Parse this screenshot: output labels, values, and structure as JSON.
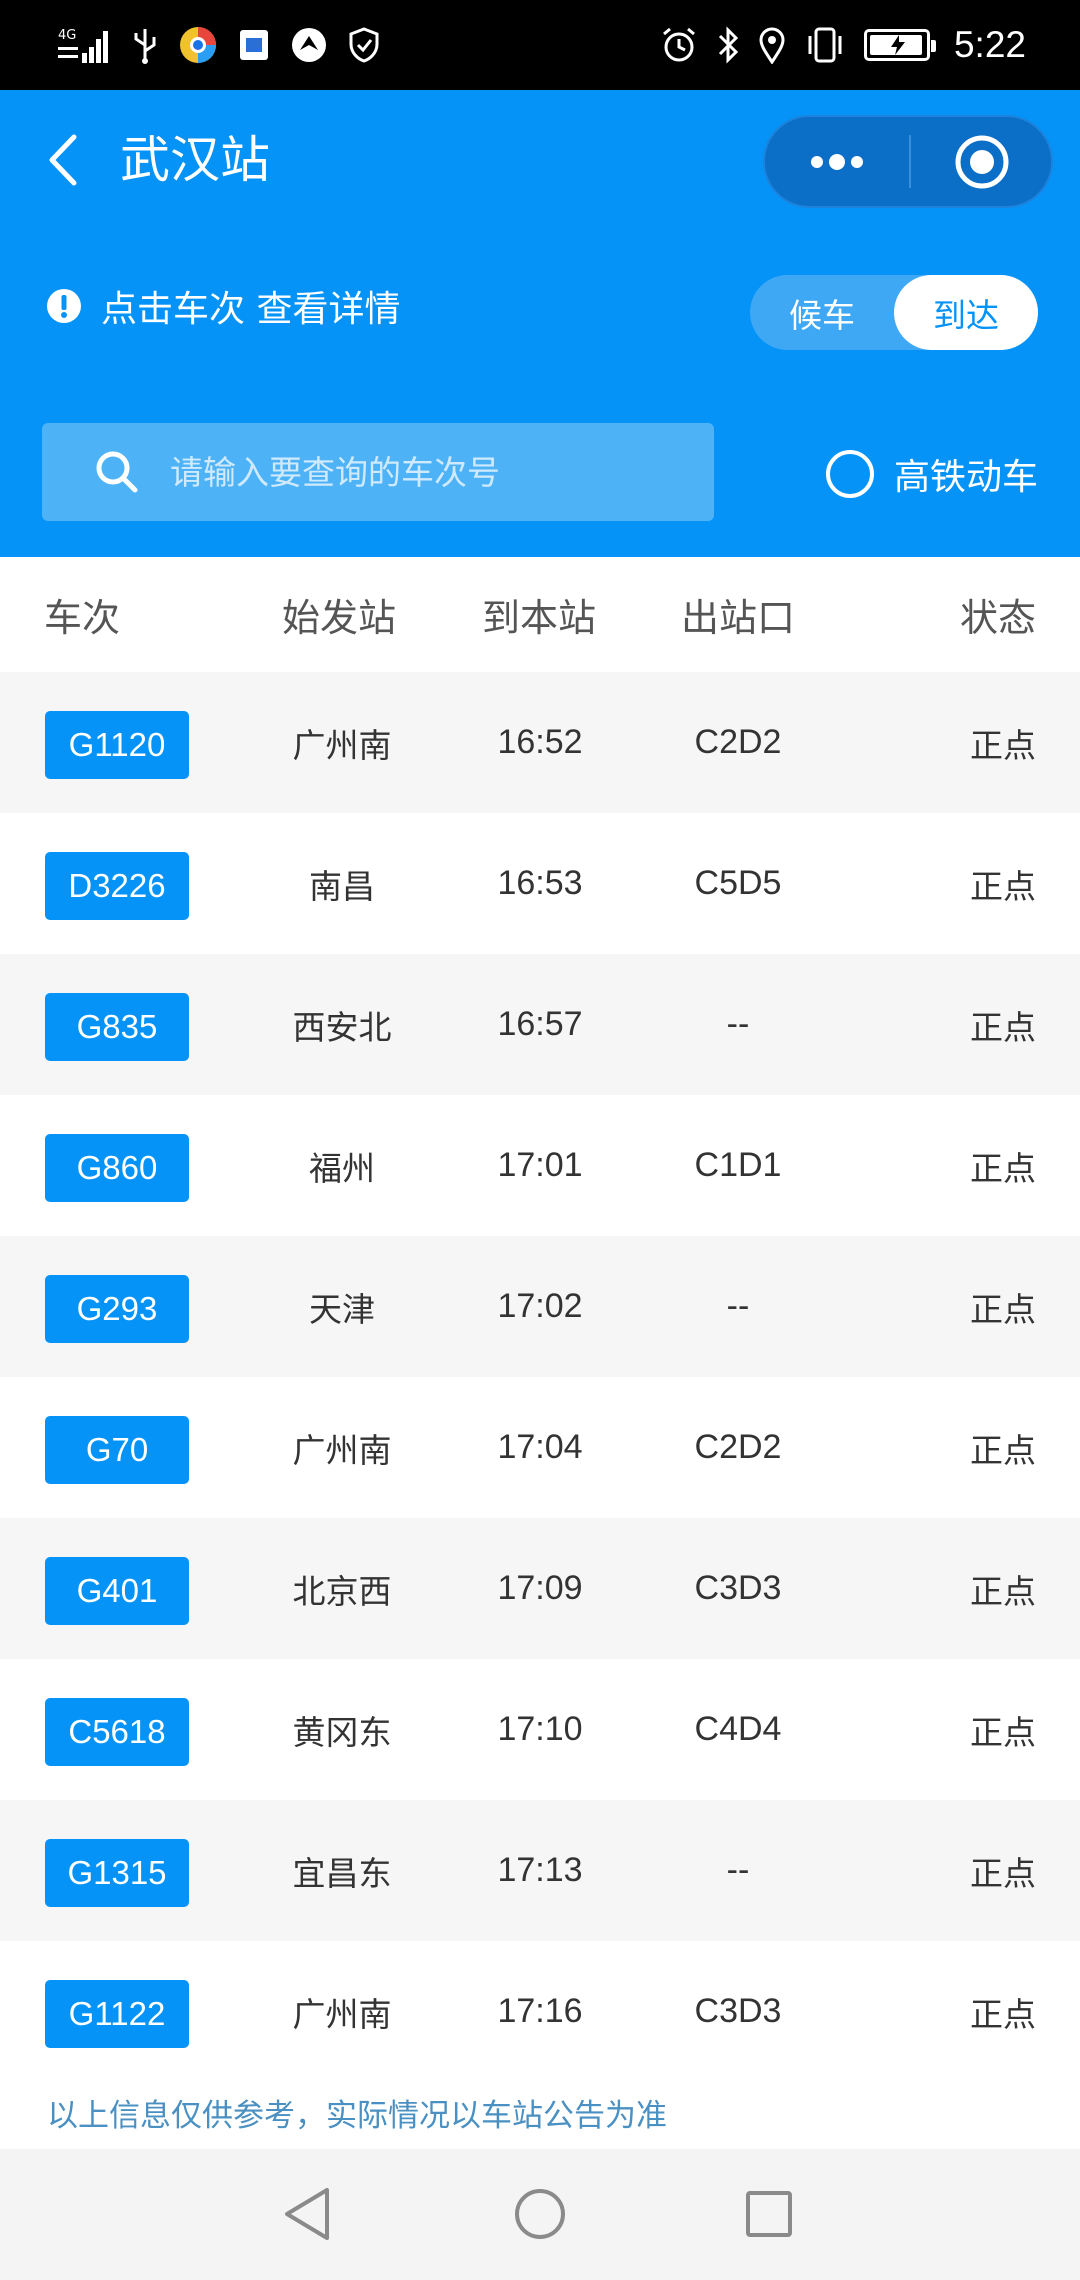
{
  "status_bar": {
    "network": "4G",
    "time": "5:22",
    "left_icons": [
      "signal-icon",
      "usb-icon",
      "browser-app-icon",
      "sim-card-icon",
      "app-notification-icon",
      "shield-icon"
    ],
    "right_icons": [
      "alarm-icon",
      "bluetooth-icon",
      "location-icon",
      "vibrate-icon",
      "battery-icon"
    ]
  },
  "header": {
    "title": "武汉站",
    "hint": "点击车次 查看详情",
    "toggle": {
      "options": [
        "候车",
        "到达"
      ],
      "selected": "到达"
    },
    "search": {
      "placeholder": "请输入要查询的车次号",
      "value": ""
    },
    "hsr_filter_label": "高铁动车",
    "hsr_filter_checked": false
  },
  "table": {
    "columns": [
      "车次",
      "始发站",
      "到本站",
      "出站口",
      "状态"
    ],
    "rows": [
      {
        "train": "G1120",
        "origin": "广州南",
        "arrive": "16:52",
        "exit": "C2D2",
        "status": "正点"
      },
      {
        "train": "D3226",
        "origin": "南昌",
        "arrive": "16:53",
        "exit": "C5D5",
        "status": "正点"
      },
      {
        "train": "G835",
        "origin": "西安北",
        "arrive": "16:57",
        "exit": "--",
        "status": "正点"
      },
      {
        "train": "G860",
        "origin": "福州",
        "arrive": "17:01",
        "exit": "C1D1",
        "status": "正点"
      },
      {
        "train": "G293",
        "origin": "天津",
        "arrive": "17:02",
        "exit": "--",
        "status": "正点"
      },
      {
        "train": "G70",
        "origin": "广州南",
        "arrive": "17:04",
        "exit": "C2D2",
        "status": "正点"
      },
      {
        "train": "G401",
        "origin": "北京西",
        "arrive": "17:09",
        "exit": "C3D3",
        "status": "正点"
      },
      {
        "train": "C5618",
        "origin": "黄冈东",
        "arrive": "17:10",
        "exit": "C4D4",
        "status": "正点"
      },
      {
        "train": "G1315",
        "origin": "宜昌东",
        "arrive": "17:13",
        "exit": "--",
        "status": "正点"
      },
      {
        "train": "G1122",
        "origin": "广州南",
        "arrive": "17:16",
        "exit": "C3D3",
        "status": "正点"
      }
    ]
  },
  "disclaimer": "以上信息仅供参考，实际情况以车站公告为准",
  "colors": {
    "primary": "#0593f7",
    "status_bar": "#000000",
    "row_alt": "#f6f6f6",
    "disclaimer": "#4a90c2"
  }
}
